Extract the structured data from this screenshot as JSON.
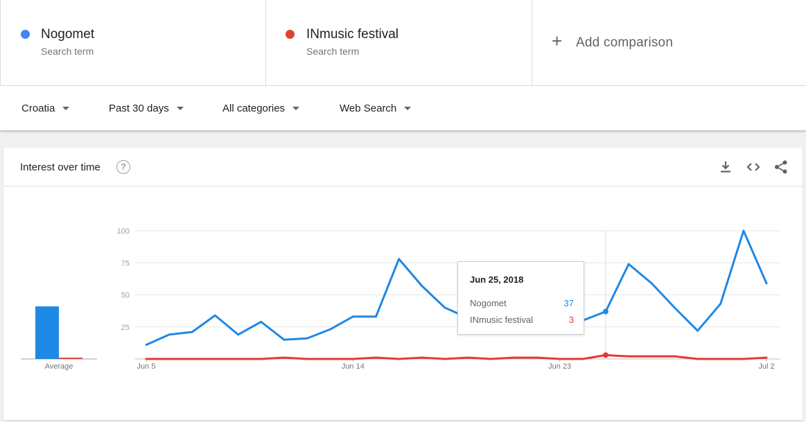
{
  "terms": [
    {
      "name": "Nogomet",
      "sub": "Search term",
      "color": "#4285f4"
    },
    {
      "name": "INmusic festival",
      "sub": "Search term",
      "color": "#db4437"
    }
  ],
  "add_comparison": {
    "icon": "+",
    "label": "Add comparison"
  },
  "filters": [
    {
      "label": "Croatia"
    },
    {
      "label": "Past 30 days"
    },
    {
      "label": "All categories"
    },
    {
      "label": "Web Search"
    }
  ],
  "card": {
    "title": "Interest over time",
    "help_icon": "?",
    "icons": [
      "download-icon",
      "embed-icon",
      "share-icon"
    ]
  },
  "average": {
    "label": "Average",
    "values": [
      {
        "series": "Nogomet",
        "value": 41,
        "color": "#1e88e5"
      },
      {
        "series": "INmusic festival",
        "value": 1,
        "color": "#e53935"
      }
    ]
  },
  "tooltip": {
    "date": "Jun 25, 2018",
    "rows": [
      {
        "name": "Nogomet",
        "value": "37",
        "color": "#1e88e5"
      },
      {
        "name": "INmusic festival",
        "value": "3",
        "color": "#e53935"
      }
    ]
  },
  "chart_data": {
    "type": "line",
    "x": [
      "Jun 5",
      "Jun 6",
      "Jun 7",
      "Jun 8",
      "Jun 9",
      "Jun 10",
      "Jun 11",
      "Jun 12",
      "Jun 13",
      "Jun 14",
      "Jun 15",
      "Jun 16",
      "Jun 17",
      "Jun 18",
      "Jun 19",
      "Jun 20",
      "Jun 21",
      "Jun 22",
      "Jun 23",
      "Jun 24",
      "Jun 25",
      "Jun 26",
      "Jun 27",
      "Jun 28",
      "Jun 29",
      "Jun 30",
      "Jul 1",
      "Jul 2"
    ],
    "x_tick_labels": [
      "Jun 5",
      "Jun 14",
      "Jun 23",
      "Jul 2"
    ],
    "series": [
      {
        "name": "Nogomet",
        "color": "#1e88e5",
        "values": [
          11,
          19,
          21,
          34,
          19,
          29,
          15,
          16,
          23,
          33,
          33,
          78,
          57,
          40,
          32,
          45,
          72,
          55,
          61,
          30,
          37,
          74,
          59,
          40,
          22,
          43,
          100,
          59
        ]
      },
      {
        "name": "INmusic festival",
        "color": "#e53935",
        "values": [
          0,
          0,
          0,
          0,
          0,
          0,
          1,
          0,
          0,
          0,
          1,
          0,
          1,
          0,
          1,
          0,
          1,
          1,
          0,
          0,
          3,
          2,
          2,
          2,
          0,
          0,
          0,
          1
        ]
      }
    ],
    "yticks": [
      25,
      50,
      75,
      100
    ],
    "ylim": [
      0,
      100
    ],
    "grid": true,
    "highlight_index": 20,
    "title": "",
    "xlabel": "",
    "ylabel": ""
  }
}
